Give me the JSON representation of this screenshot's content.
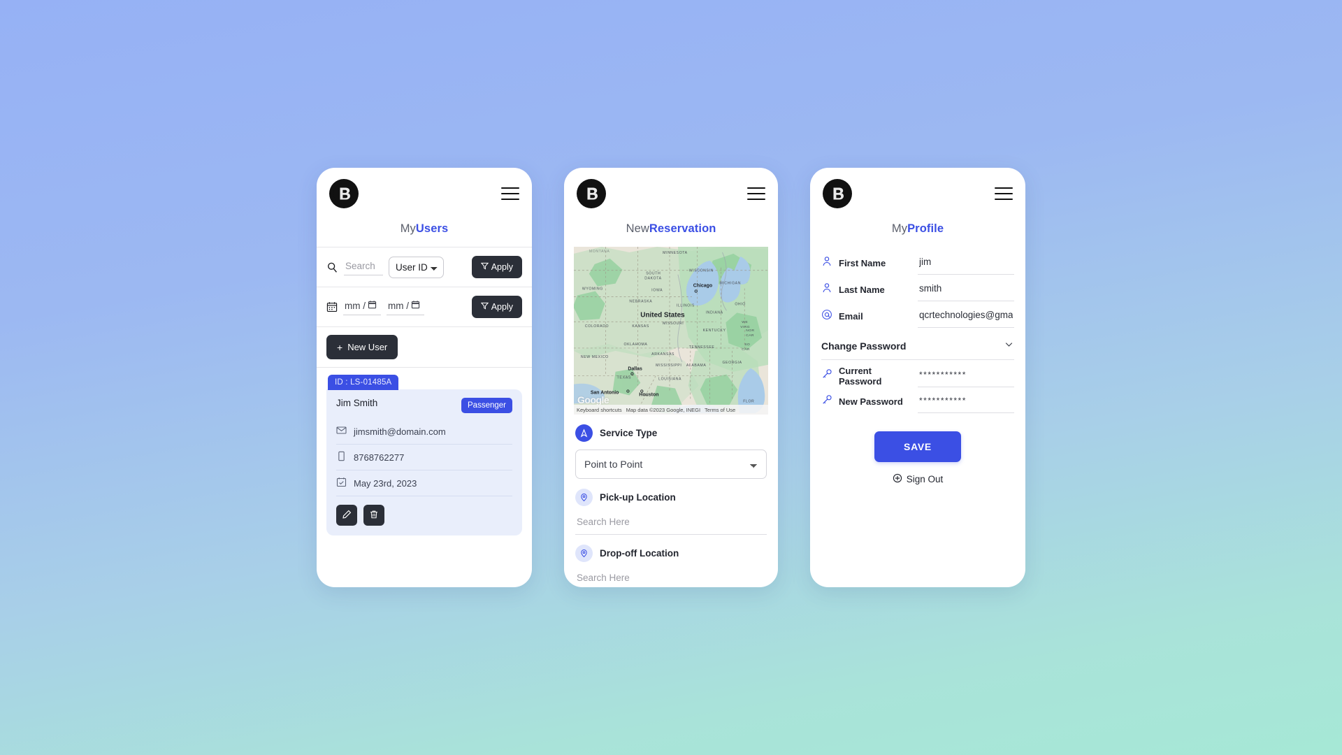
{
  "theme": {
    "accent": "#3b4fe4",
    "dark_button": "#2b2f38",
    "card_bg": "#e9eefb",
    "bg_gradient_top": "#96b1f5",
    "bg_gradient_bottom": "#a6e8d6"
  },
  "screens": {
    "users": {
      "logo_letter": "B",
      "title_prefix": "My",
      "title_accent": "Users",
      "search": {
        "placeholder": "Search",
        "value": "",
        "select_value": "User ID",
        "options": [
          "User ID"
        ],
        "apply_label": "Apply"
      },
      "date_filter": {
        "from_placeholder": "mm /",
        "to_placeholder": "mm /",
        "apply_label": "Apply"
      },
      "new_user_label": "New User",
      "new_user_plus": "+",
      "user_card": {
        "id_label": "ID : LS-01485A",
        "name": "Jim Smith",
        "role": "Passenger",
        "email": "jimsmith@domain.com",
        "phone": "8768762277",
        "date": "May 23rd, 2023"
      }
    },
    "reservation": {
      "logo_letter": "B",
      "title_prefix": "New",
      "title_accent": "Reservation",
      "map": {
        "country_label": "United States",
        "city_labels": [
          "Chicago",
          "Dallas",
          "Houston",
          "San Antonio"
        ],
        "state_labels": [
          "MONTANA",
          "MINNESOTA",
          "SOUTH DAKOTA",
          "WISCONSIN",
          "MICHIGAN",
          "WYOMING",
          "IOWA",
          "NEBRASKA",
          "ILLINOIS",
          "INDIANA",
          "OHIO",
          "COLORADO",
          "KANSAS",
          "MISSOURI",
          "KENTUCKY",
          "WE VIRG",
          "OKLAHOMA",
          "ARKANSAS",
          "TENNESSEE",
          "NEW MEXICO",
          "MISSISSIPPI",
          "ALABAMA",
          "GEORGIA",
          "TEXAS",
          "LOUISIANA",
          "SO CAR",
          "FLOR",
          "NOR CAR"
        ],
        "watermark": "Google",
        "keyboard_shortcuts": "Keyboard shortcuts",
        "map_data": "Map data ©2023 Google, INEGI",
        "terms": "Terms of Use"
      },
      "service_type": {
        "label": "Service Type",
        "value": "Point to Point",
        "options": [
          "Point to Point"
        ]
      },
      "pickup": {
        "label": "Pick-up Location",
        "placeholder": "Search Here",
        "value": ""
      },
      "dropoff": {
        "label": "Drop-off Location",
        "placeholder": "Search Here",
        "value": ""
      }
    },
    "profile": {
      "logo_letter": "B",
      "title_prefix": "My",
      "title_accent": "Profile",
      "fields": {
        "first_name_label": "First Name",
        "first_name_value": "jim",
        "last_name_label": "Last Name",
        "last_name_value": "smith",
        "email_label": "Email",
        "email_value": "qcrtechnologies@gma"
      },
      "change_password_label": "Change Password",
      "current_password_label": "Current Password",
      "current_password_value": "***********",
      "new_password_label": "New Password",
      "new_password_value": "***********",
      "save_label": "SAVE",
      "sign_out_label": "Sign Out"
    }
  }
}
